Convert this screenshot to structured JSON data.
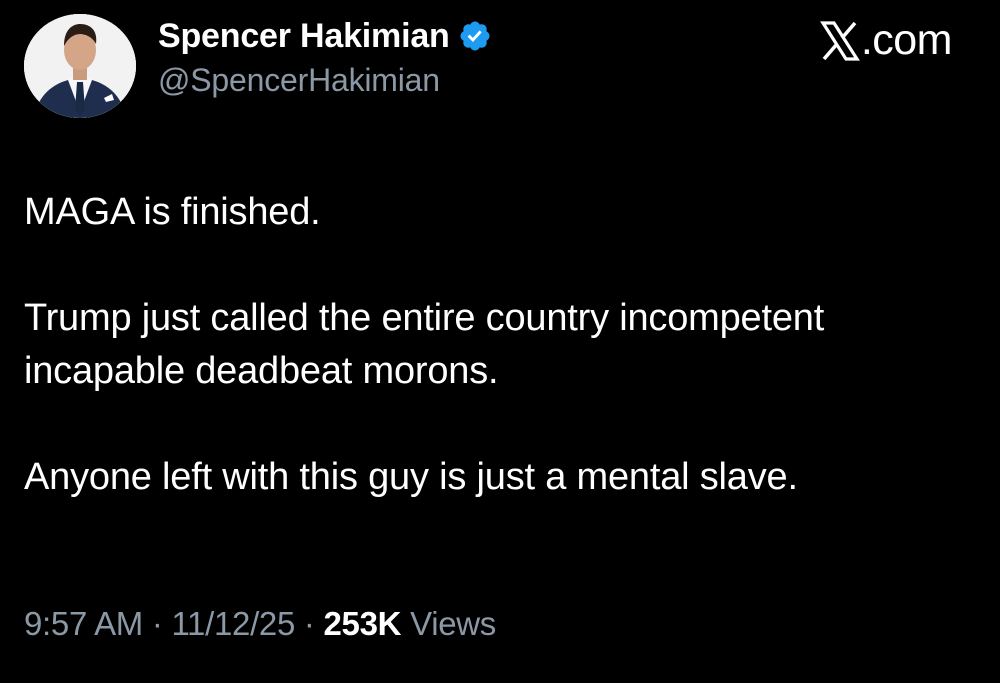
{
  "author": {
    "display_name": "Spencer Hakimian",
    "handle": "@SpencerHakimian",
    "verified": true,
    "avatar_icon": "profile-photo-man-in-suit"
  },
  "brand": {
    "label": ".com",
    "icon": "x-logo-icon"
  },
  "tweet": {
    "paragraphs": [
      "MAGA is finished.",
      "Trump just called the entire country incompetent incapable deadbeat morons.",
      "Anyone left with this guy is just a mental slave."
    ]
  },
  "meta": {
    "time": "9:57 AM",
    "separator": "·",
    "date": "11/12/25",
    "views_count": "253K",
    "views_label": "Views"
  },
  "colors": {
    "background": "#000000",
    "text_primary": "#ffffff",
    "text_secondary": "#8b98a5",
    "verified_badge": "#1d9bf0"
  }
}
